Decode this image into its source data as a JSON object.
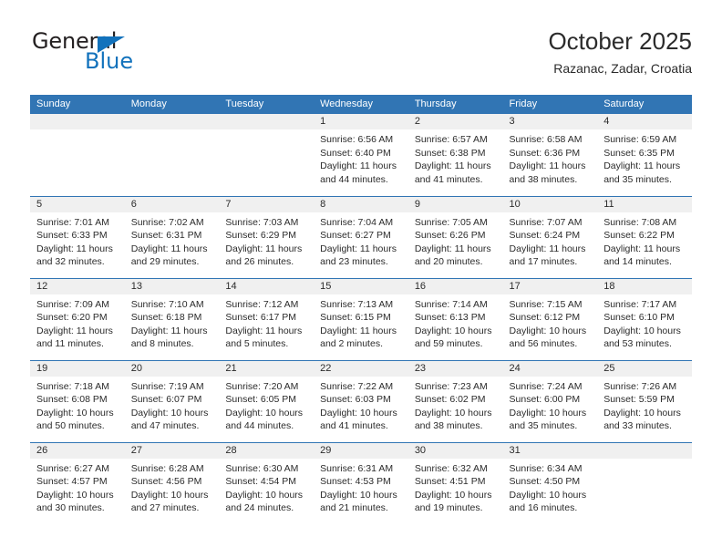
{
  "brand": {
    "name_top": "General",
    "name_bottom": "Blue",
    "triangle_icon": "blue-triangle-logo-mark",
    "color_dark": "#231f20",
    "color_blue": "#1272bc"
  },
  "header": {
    "title": "October 2025",
    "subtitle": "Razanac, Zadar, Croatia"
  },
  "theme": {
    "header_blue": "#3175b4",
    "daynum_band": "#f0f0f0",
    "text": "#2b2b2b"
  },
  "calendar": {
    "weekday_headers": [
      "Sunday",
      "Monday",
      "Tuesday",
      "Wednesday",
      "Thursday",
      "Friday",
      "Saturday"
    ],
    "weeks": [
      [
        {
          "day": "",
          "empty": true,
          "sunrise": "",
          "sunset": "",
          "daylight_line1": "",
          "daylight_line2": ""
        },
        {
          "day": "",
          "empty": true,
          "sunrise": "",
          "sunset": "",
          "daylight_line1": "",
          "daylight_line2": ""
        },
        {
          "day": "",
          "empty": true,
          "sunrise": "",
          "sunset": "",
          "daylight_line1": "",
          "daylight_line2": ""
        },
        {
          "day": "1",
          "sunrise": "Sunrise: 6:56 AM",
          "sunset": "Sunset: 6:40 PM",
          "daylight_line1": "Daylight: 11 hours",
          "daylight_line2": "and 44 minutes."
        },
        {
          "day": "2",
          "sunrise": "Sunrise: 6:57 AM",
          "sunset": "Sunset: 6:38 PM",
          "daylight_line1": "Daylight: 11 hours",
          "daylight_line2": "and 41 minutes."
        },
        {
          "day": "3",
          "sunrise": "Sunrise: 6:58 AM",
          "sunset": "Sunset: 6:36 PM",
          "daylight_line1": "Daylight: 11 hours",
          "daylight_line2": "and 38 minutes."
        },
        {
          "day": "4",
          "sunrise": "Sunrise: 6:59 AM",
          "sunset": "Sunset: 6:35 PM",
          "daylight_line1": "Daylight: 11 hours",
          "daylight_line2": "and 35 minutes."
        }
      ],
      [
        {
          "day": "5",
          "sunrise": "Sunrise: 7:01 AM",
          "sunset": "Sunset: 6:33 PM",
          "daylight_line1": "Daylight: 11 hours",
          "daylight_line2": "and 32 minutes."
        },
        {
          "day": "6",
          "sunrise": "Sunrise: 7:02 AM",
          "sunset": "Sunset: 6:31 PM",
          "daylight_line1": "Daylight: 11 hours",
          "daylight_line2": "and 29 minutes."
        },
        {
          "day": "7",
          "sunrise": "Sunrise: 7:03 AM",
          "sunset": "Sunset: 6:29 PM",
          "daylight_line1": "Daylight: 11 hours",
          "daylight_line2": "and 26 minutes."
        },
        {
          "day": "8",
          "sunrise": "Sunrise: 7:04 AM",
          "sunset": "Sunset: 6:27 PM",
          "daylight_line1": "Daylight: 11 hours",
          "daylight_line2": "and 23 minutes."
        },
        {
          "day": "9",
          "sunrise": "Sunrise: 7:05 AM",
          "sunset": "Sunset: 6:26 PM",
          "daylight_line1": "Daylight: 11 hours",
          "daylight_line2": "and 20 minutes."
        },
        {
          "day": "10",
          "sunrise": "Sunrise: 7:07 AM",
          "sunset": "Sunset: 6:24 PM",
          "daylight_line1": "Daylight: 11 hours",
          "daylight_line2": "and 17 minutes."
        },
        {
          "day": "11",
          "sunrise": "Sunrise: 7:08 AM",
          "sunset": "Sunset: 6:22 PM",
          "daylight_line1": "Daylight: 11 hours",
          "daylight_line2": "and 14 minutes."
        }
      ],
      [
        {
          "day": "12",
          "sunrise": "Sunrise: 7:09 AM",
          "sunset": "Sunset: 6:20 PM",
          "daylight_line1": "Daylight: 11 hours",
          "daylight_line2": "and 11 minutes."
        },
        {
          "day": "13",
          "sunrise": "Sunrise: 7:10 AM",
          "sunset": "Sunset: 6:18 PM",
          "daylight_line1": "Daylight: 11 hours",
          "daylight_line2": "and 8 minutes."
        },
        {
          "day": "14",
          "sunrise": "Sunrise: 7:12 AM",
          "sunset": "Sunset: 6:17 PM",
          "daylight_line1": "Daylight: 11 hours",
          "daylight_line2": "and 5 minutes."
        },
        {
          "day": "15",
          "sunrise": "Sunrise: 7:13 AM",
          "sunset": "Sunset: 6:15 PM",
          "daylight_line1": "Daylight: 11 hours",
          "daylight_line2": "and 2 minutes."
        },
        {
          "day": "16",
          "sunrise": "Sunrise: 7:14 AM",
          "sunset": "Sunset: 6:13 PM",
          "daylight_line1": "Daylight: 10 hours",
          "daylight_line2": "and 59 minutes."
        },
        {
          "day": "17",
          "sunrise": "Sunrise: 7:15 AM",
          "sunset": "Sunset: 6:12 PM",
          "daylight_line1": "Daylight: 10 hours",
          "daylight_line2": "and 56 minutes."
        },
        {
          "day": "18",
          "sunrise": "Sunrise: 7:17 AM",
          "sunset": "Sunset: 6:10 PM",
          "daylight_line1": "Daylight: 10 hours",
          "daylight_line2": "and 53 minutes."
        }
      ],
      [
        {
          "day": "19",
          "sunrise": "Sunrise: 7:18 AM",
          "sunset": "Sunset: 6:08 PM",
          "daylight_line1": "Daylight: 10 hours",
          "daylight_line2": "and 50 minutes."
        },
        {
          "day": "20",
          "sunrise": "Sunrise: 7:19 AM",
          "sunset": "Sunset: 6:07 PM",
          "daylight_line1": "Daylight: 10 hours",
          "daylight_line2": "and 47 minutes."
        },
        {
          "day": "21",
          "sunrise": "Sunrise: 7:20 AM",
          "sunset": "Sunset: 6:05 PM",
          "daylight_line1": "Daylight: 10 hours",
          "daylight_line2": "and 44 minutes."
        },
        {
          "day": "22",
          "sunrise": "Sunrise: 7:22 AM",
          "sunset": "Sunset: 6:03 PM",
          "daylight_line1": "Daylight: 10 hours",
          "daylight_line2": "and 41 minutes."
        },
        {
          "day": "23",
          "sunrise": "Sunrise: 7:23 AM",
          "sunset": "Sunset: 6:02 PM",
          "daylight_line1": "Daylight: 10 hours",
          "daylight_line2": "and 38 minutes."
        },
        {
          "day": "24",
          "sunrise": "Sunrise: 7:24 AM",
          "sunset": "Sunset: 6:00 PM",
          "daylight_line1": "Daylight: 10 hours",
          "daylight_line2": "and 35 minutes."
        },
        {
          "day": "25",
          "sunrise": "Sunrise: 7:26 AM",
          "sunset": "Sunset: 5:59 PM",
          "daylight_line1": "Daylight: 10 hours",
          "daylight_line2": "and 33 minutes."
        }
      ],
      [
        {
          "day": "26",
          "sunrise": "Sunrise: 6:27 AM",
          "sunset": "Sunset: 4:57 PM",
          "daylight_line1": "Daylight: 10 hours",
          "daylight_line2": "and 30 minutes."
        },
        {
          "day": "27",
          "sunrise": "Sunrise: 6:28 AM",
          "sunset": "Sunset: 4:56 PM",
          "daylight_line1": "Daylight: 10 hours",
          "daylight_line2": "and 27 minutes."
        },
        {
          "day": "28",
          "sunrise": "Sunrise: 6:30 AM",
          "sunset": "Sunset: 4:54 PM",
          "daylight_line1": "Daylight: 10 hours",
          "daylight_line2": "and 24 minutes."
        },
        {
          "day": "29",
          "sunrise": "Sunrise: 6:31 AM",
          "sunset": "Sunset: 4:53 PM",
          "daylight_line1": "Daylight: 10 hours",
          "daylight_line2": "and 21 minutes."
        },
        {
          "day": "30",
          "sunrise": "Sunrise: 6:32 AM",
          "sunset": "Sunset: 4:51 PM",
          "daylight_line1": "Daylight: 10 hours",
          "daylight_line2": "and 19 minutes."
        },
        {
          "day": "31",
          "sunrise": "Sunrise: 6:34 AM",
          "sunset": "Sunset: 4:50 PM",
          "daylight_line1": "Daylight: 10 hours",
          "daylight_line2": "and 16 minutes."
        },
        {
          "day": "",
          "empty": true,
          "sunrise": "",
          "sunset": "",
          "daylight_line1": "",
          "daylight_line2": ""
        }
      ]
    ]
  }
}
